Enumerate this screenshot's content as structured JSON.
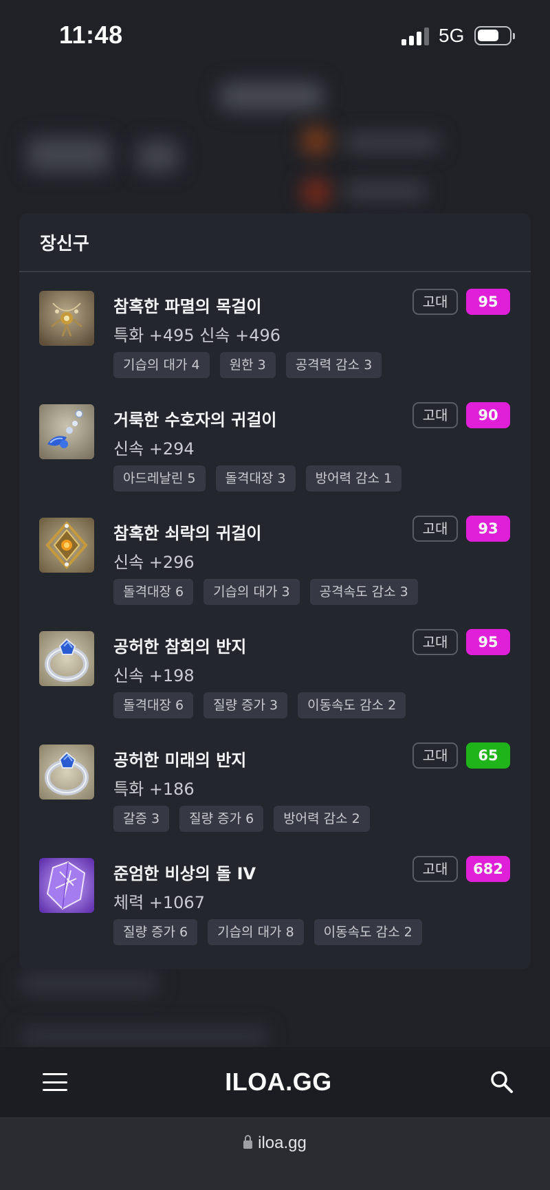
{
  "status": {
    "time": "11:48",
    "network": "5G"
  },
  "card": {
    "title": "장신구",
    "items": [
      {
        "name": "참혹한 파멸의 목걸이",
        "stat": "특화 +495  신속 +496",
        "grade": "고대",
        "quality": "95",
        "quality_color": "#e020d8",
        "icon": "necklace-icon",
        "engravings": [
          "기습의 대가 4",
          "원한 3",
          "공격력 감소 3"
        ]
      },
      {
        "name": "거룩한 수호자의 귀걸이",
        "stat": "신속 +294",
        "grade": "고대",
        "quality": "90",
        "quality_color": "#e020d8",
        "icon": "earring-blue-icon",
        "engravings": [
          "아드레날린 5",
          "돌격대장 3",
          "방어력 감소 1"
        ]
      },
      {
        "name": "참혹한 쇠락의 귀걸이",
        "stat": "신속 +296",
        "grade": "고대",
        "quality": "93",
        "quality_color": "#e020d8",
        "icon": "earring-gold-icon",
        "engravings": [
          "돌격대장 6",
          "기습의 대가 3",
          "공격속도 감소 3"
        ]
      },
      {
        "name": "공허한 참회의 반지",
        "stat": "신속 +198",
        "grade": "고대",
        "quality": "95",
        "quality_color": "#e020d8",
        "icon": "ring-icon",
        "engravings": [
          "돌격대장 6",
          "질량 증가 3",
          "이동속도 감소 2"
        ]
      },
      {
        "name": "공허한 미래의 반지",
        "stat": "특화 +186",
        "grade": "고대",
        "quality": "65",
        "quality_color": "#1fb51a",
        "icon": "ring-icon",
        "engravings": [
          "갈증 3",
          "질량 증가 6",
          "방어력 감소 2"
        ]
      },
      {
        "name": "준엄한 비상의 돌 IV",
        "stat": "체력 +1067",
        "grade": "고대",
        "quality": "682",
        "quality_color": "#e020d8",
        "icon": "ability-stone-icon",
        "engravings": [
          "질량 증가 6",
          "기습의 대가 8",
          "이동속도 감소 2"
        ]
      }
    ]
  },
  "bottom_nav": {
    "logo": "ILOA.GG"
  },
  "browser": {
    "url": "iloa.gg"
  }
}
